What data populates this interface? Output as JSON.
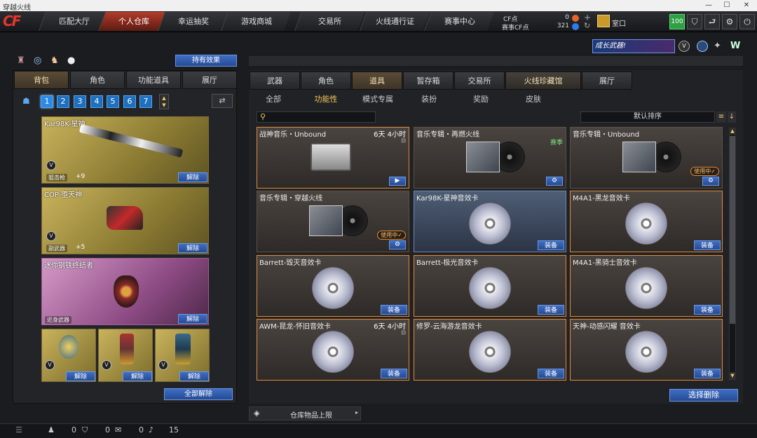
{
  "window": {
    "title": "穿越火线",
    "controls": [
      "—",
      "☐",
      "✕"
    ]
  },
  "logo": "CF",
  "nav": {
    "tabs": [
      "匹配大厅",
      "个人仓库",
      "幸运抽奖",
      "游戏商城",
      "交易所",
      "火线通行证",
      "赛事中心"
    ],
    "active_index": 1
  },
  "currency": {
    "cf_label": "CF点",
    "cf_value": "0",
    "match_label": "赛事CF点",
    "match_value": "321"
  },
  "player": {
    "name": "室口",
    "level": "100"
  },
  "left": {
    "effects_button": "持有效果",
    "tabs": [
      "背包",
      "角色",
      "功能道具",
      "展厅"
    ],
    "active_tab": 0,
    "pages": [
      "1",
      "2",
      "3",
      "4",
      "5",
      "6",
      "7"
    ],
    "active_page": 0,
    "weapons": [
      {
        "name": "Kar98K-星神",
        "type": "狙击枪",
        "bonus": "+9",
        "button": "解除"
      },
      {
        "name": "COP-堕天神",
        "type": "副武器",
        "bonus": "+5",
        "button": "解除"
      },
      {
        "name": "迷你钢铁终结者",
        "type": "近身武器",
        "bonus": "",
        "button": "解除"
      }
    ],
    "small_slots": [
      {
        "button": "解除"
      },
      {
        "button": "解除"
      },
      {
        "button": "解除"
      }
    ],
    "remove_all": "全部解除"
  },
  "banner": {
    "text": "成长武器!"
  },
  "right": {
    "tabs": [
      "武器",
      "角色",
      "道具",
      "暂存箱",
      "交易所",
      "火线珍藏馆",
      "展厅"
    ],
    "active_tab": 2,
    "subtabs": [
      "全部",
      "功能性",
      "模式专属",
      "装扮",
      "奖励",
      "皮肤"
    ],
    "active_subtab": 1,
    "search_placeholder": "",
    "sort_label": "默认排序",
    "items": [
      {
        "name": "战神音乐・Unbound",
        "time": "6天 4小时",
        "kind": "tape",
        "tag": "",
        "button": "▶"
      },
      {
        "name": "音乐专辑・再燃火线",
        "time": "",
        "kind": "album",
        "tag": "赛季",
        "button": "⚙"
      },
      {
        "name": "音乐专辑・Unbound",
        "time": "",
        "kind": "album",
        "tag": "使用中✓",
        "button": "⚙"
      },
      {
        "name": "音乐专辑・穿越火线",
        "time": "",
        "kind": "album",
        "tag": "使用中✓",
        "button": "⚙"
      },
      {
        "name": "Kar98K-星神音效卡",
        "time": "",
        "kind": "disc",
        "tag": "",
        "button": "装备"
      },
      {
        "name": "M4A1-黑龙音效卡",
        "time": "",
        "kind": "disc",
        "tag": "",
        "button": "装备"
      },
      {
        "name": "Barrett-毁灭音效卡",
        "time": "",
        "kind": "disc",
        "tag": "",
        "button": "装备"
      },
      {
        "name": "Barrett-极光音效卡",
        "time": "",
        "kind": "disc",
        "tag": "",
        "button": "装备"
      },
      {
        "name": "M4A1-黑骑士音效卡",
        "time": "",
        "kind": "disc",
        "tag": "",
        "button": "装备"
      },
      {
        "name": "AWM-昆龙-怀旧音效卡",
        "time": "6天 4小时",
        "kind": "disc",
        "tag": "",
        "button": "装备"
      },
      {
        "name": "修罗-云海游龙音效卡",
        "time": "",
        "kind": "disc",
        "tag": "",
        "button": "装备"
      },
      {
        "name": "天神-动感闪耀 音效卡",
        "time": "",
        "kind": "disc",
        "tag": "",
        "button": "装备"
      }
    ],
    "select_delete": "选择删除",
    "storage_limit": "仓库物品上限"
  },
  "statusbar": {
    "v1": "0",
    "v2": "0",
    "v3": "0",
    "v4": "15"
  }
}
